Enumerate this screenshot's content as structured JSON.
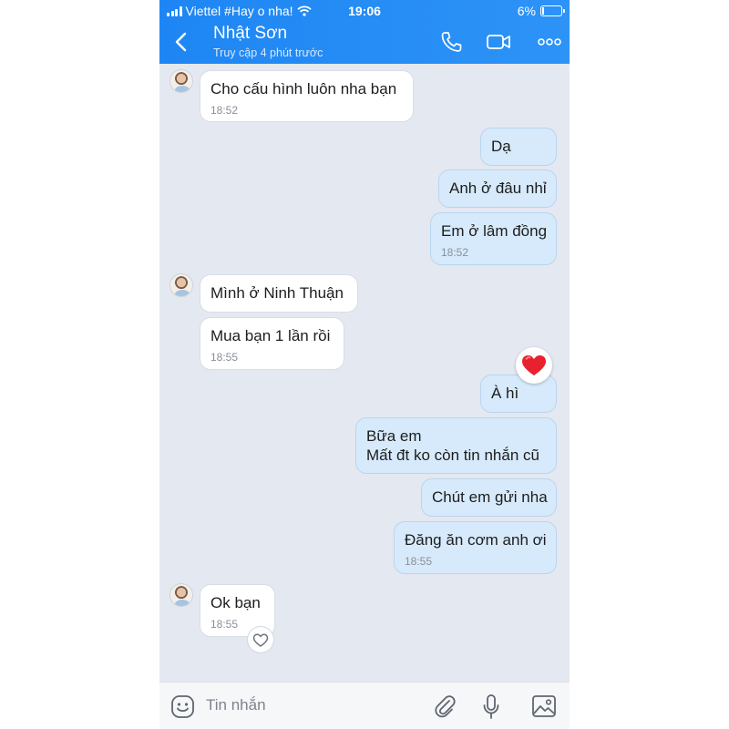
{
  "status_bar": {
    "carrier": "Viettel #Hay o nha!",
    "time": "19:06",
    "battery": "6%"
  },
  "header": {
    "contact_name": "Nhật Sơn",
    "contact_status": "Truy cập 4 phút trước",
    "icons": [
      "back-icon",
      "phone-icon",
      "video-icon",
      "more-icon"
    ]
  },
  "messages": [
    {
      "side": "in",
      "text": "Cho cấu hình luôn nha bạn",
      "time": "18:52"
    },
    {
      "side": "out",
      "text": "Dạ",
      "time": ""
    },
    {
      "side": "out",
      "text": "Anh ở đâu nhỉ",
      "time": ""
    },
    {
      "side": "out",
      "text": "Em ở lâm đồng",
      "time": "18:52"
    },
    {
      "side": "in",
      "text": "Mình ở Ninh Thuận",
      "time": ""
    },
    {
      "side": "in",
      "text": "Mua bạn 1 lần rồi",
      "time": "18:55"
    },
    {
      "side": "out",
      "text": "À hì",
      "time": "",
      "reaction": "heart"
    },
    {
      "side": "out",
      "lines": [
        "Bữa em",
        "Mất đt ko còn tin nhắn cũ"
      ],
      "time": ""
    },
    {
      "side": "out",
      "text": "Chút em gửi nha",
      "time": ""
    },
    {
      "side": "out",
      "text": "Đăng ăn cơm anh ơi",
      "time": "18:55"
    },
    {
      "side": "in",
      "text": "Ok bạn",
      "time": "18:55"
    }
  ],
  "input": {
    "placeholder": "Tin nhắn",
    "icons": [
      "emoji-icon",
      "attachment-icon",
      "microphone-icon",
      "image-icon"
    ]
  },
  "colors": {
    "header": "#2d93f7",
    "chat_background": "#e4e8f1",
    "outgoing_bubble": "#d7eafb",
    "incoming_bubble": "#ffffff",
    "reaction_heart": "#e8212f"
  }
}
